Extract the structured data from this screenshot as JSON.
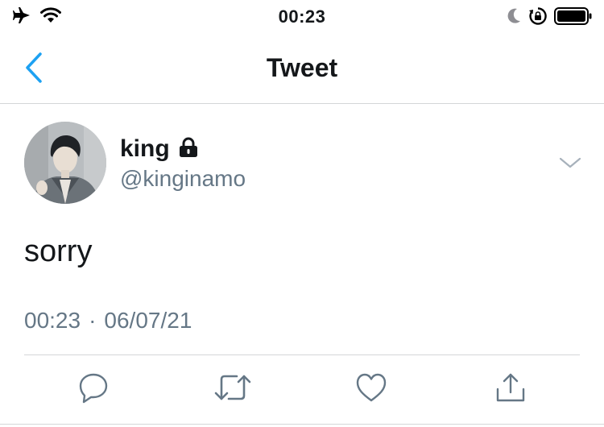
{
  "status_bar": {
    "time": "00:23",
    "icons": [
      "airplane-icon",
      "wifi-icon",
      "moon-icon",
      "rotation-lock-icon",
      "battery-icon"
    ]
  },
  "nav": {
    "title": "Tweet",
    "back_icon": "chevron-left-icon"
  },
  "tweet": {
    "display_name": "king",
    "protected_icon": "lock-icon",
    "handle": "@kinginamo",
    "text": "sorry",
    "time": "00:23",
    "separator": "·",
    "date": "06/07/21",
    "actions": [
      "reply-icon",
      "retweet-icon",
      "like-icon",
      "share-icon"
    ]
  },
  "colors": {
    "accent": "#1da1f2",
    "secondary_text": "#657786",
    "divider": "#d4d6d8"
  }
}
